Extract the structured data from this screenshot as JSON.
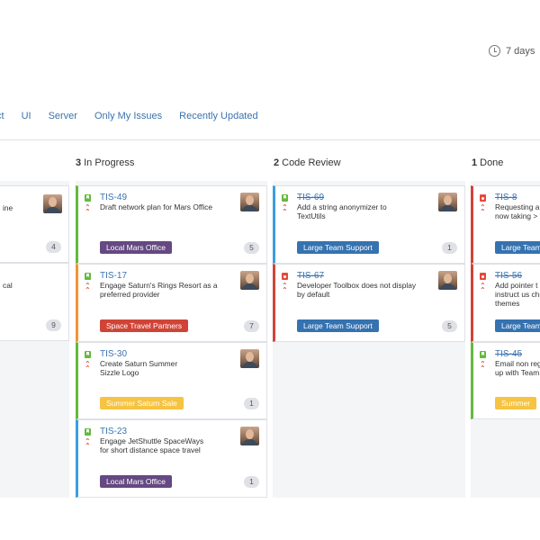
{
  "header": {
    "time_filter": "7 days"
  },
  "filters": [
    "ct",
    "UI",
    "Server",
    "Only My Issues",
    "Recently Updated"
  ],
  "columns": [
    {
      "count": "",
      "name": ""
    },
    {
      "count": "3",
      "name": "In Progress"
    },
    {
      "count": "2",
      "name": "Code Review"
    },
    {
      "count": "1",
      "name": "Done"
    }
  ],
  "cards": [
    {
      "key": "",
      "summary": "ine",
      "epic": "",
      "count": "4"
    },
    {
      "key": "",
      "summary": "cal",
      "epic": "",
      "count": "9"
    },
    {
      "key": "TIS-49",
      "summary": "Draft network plan for Mars Office",
      "epic": "Local Mars Office",
      "count": "5"
    },
    {
      "key": "TIS-17",
      "summary": "Engage Saturn's Rings Resort as a preferred provider",
      "epic": "Space Travel Partners",
      "count": "7"
    },
    {
      "key": "TIS-30",
      "summary": "Create Saturn Summer Sizzle Logo",
      "epic": "Summer Saturn Sale",
      "count": "1"
    },
    {
      "key": "TIS-23",
      "summary": "Engage JetShuttle SpaceWays for short distance space travel",
      "epic": "Local Mars Office",
      "count": "1"
    },
    {
      "key": "TIS-69",
      "summary": "Add a string anonymizer to TextUtils",
      "epic": "Large Team Support",
      "count": "1"
    },
    {
      "key": "TIS-67",
      "summary": "Developer Toolbox does not display by default",
      "epic": "Large Team Support",
      "count": "5"
    },
    {
      "key": "TIS-8",
      "summary": "Requesting a now taking >",
      "epic": "Large Team",
      "count": ""
    },
    {
      "key": "TIS-56",
      "summary": "Add pointer t to instruct us child themes",
      "epic": "Large Team",
      "count": ""
    },
    {
      "key": "TIS-45",
      "summary": "Email non reg up with Team",
      "epic": "Summer",
      "count": ""
    }
  ],
  "colors": {
    "link": "#3b73af",
    "green": "#63ba3c",
    "orange": "#f79232",
    "blue": "#3b9ede",
    "red": "#d04437",
    "epic_purple": "#654982",
    "epic_red": "#d04437",
    "epic_yellow": "#f6c342",
    "epic_blue": "#3572b0"
  }
}
